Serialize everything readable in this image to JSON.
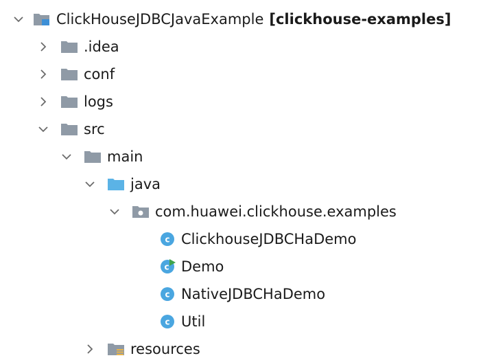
{
  "tree": {
    "root": {
      "name": "ClickHouseJDBCJavaExample",
      "module": "[clickhouse-examples]",
      "icon": "module-folder-icon",
      "expanded": true
    },
    "idea": {
      "name": ".idea",
      "icon": "folder-icon",
      "expanded": false
    },
    "conf": {
      "name": "conf",
      "icon": "folder-icon",
      "expanded": false
    },
    "logs": {
      "name": "logs",
      "icon": "folder-icon",
      "expanded": false
    },
    "src": {
      "name": "src",
      "icon": "folder-icon",
      "expanded": true
    },
    "main": {
      "name": "main",
      "icon": "folder-icon",
      "expanded": true
    },
    "java": {
      "name": "java",
      "icon": "source-root-folder-icon",
      "expanded": true
    },
    "package": {
      "name": "com.huawei.clickhouse.examples",
      "icon": "package-icon",
      "expanded": true
    },
    "classes": [
      {
        "name": "ClickhouseJDBCHaDemo",
        "icon": "java-class-icon"
      },
      {
        "name": "Demo",
        "icon": "java-runnable-class-icon"
      },
      {
        "name": "NativeJDBCHaDemo",
        "icon": "java-class-icon"
      },
      {
        "name": "Util",
        "icon": "java-class-icon"
      }
    ],
    "resources": {
      "name": "resources",
      "icon": "resources-folder-icon",
      "expanded": false
    }
  },
  "colors": {
    "folder": "#8f9aa6",
    "source_folder": "#5bb3e6",
    "class_circle": "#4aa6e0",
    "run_marker": "#3fa34d",
    "resources_marker": "#e8b44a",
    "arrow": "#6b6b6b"
  }
}
